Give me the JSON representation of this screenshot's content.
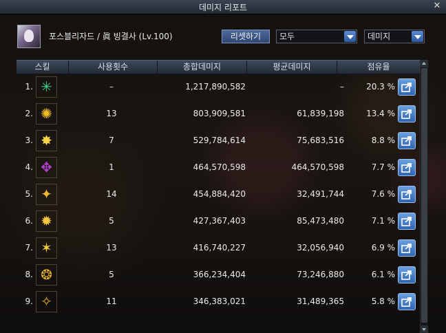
{
  "window": {
    "title": "데미지 리포트",
    "close_glyph": "✕"
  },
  "character": {
    "name": "포스블리자드 / 眞 빙결사 (Lv.100)"
  },
  "controls": {
    "reset_label": "리셋하기",
    "filter_value": "모두",
    "sort_value": "데미지"
  },
  "columns": {
    "skill": "스킬",
    "uses": "사용횟수",
    "total": "총합데미지",
    "avg": "평균데미지",
    "share": "점유율"
  },
  "rows": [
    {
      "rank": "1.",
      "icon": "green-frost-skill-icon",
      "icon_color": "#3fd08a",
      "icon_glyph": "✳",
      "uses": "–",
      "total": "1,217,890,582",
      "avg": "–",
      "pct": "20.3 %"
    },
    {
      "rank": "2.",
      "icon": "golden-flame-skill-icon",
      "icon_color": "#f4c02a",
      "icon_glyph": "✺",
      "uses": "13",
      "total": "803,909,581",
      "avg": "61,839,198",
      "pct": "13.4 %"
    },
    {
      "rank": "3.",
      "icon": "golden-burst-skill-icon",
      "icon_color": "#f7d34a",
      "icon_glyph": "✸",
      "uses": "7",
      "total": "529,784,614",
      "avg": "75,683,516",
      "pct": "8.8 %"
    },
    {
      "rank": "4.",
      "icon": "purple-rune-skill-icon",
      "icon_color": "#b040d0",
      "icon_glyph": "✥",
      "uses": "1",
      "total": "464,570,598",
      "avg": "464,570,598",
      "pct": "7.7 %"
    },
    {
      "rank": "5.",
      "icon": "golden-shards-skill-icon",
      "icon_color": "#f0b830",
      "icon_glyph": "✦",
      "uses": "14",
      "total": "454,884,420",
      "avg": "32,491,744",
      "pct": "7.6 %"
    },
    {
      "rank": "6.",
      "icon": "golden-explosion-skill-icon",
      "icon_color": "#f6c640",
      "icon_glyph": "✹",
      "uses": "5",
      "total": "427,367,403",
      "avg": "85,473,480",
      "pct": "7.1 %"
    },
    {
      "rank": "7.",
      "icon": "golden-star-skill-icon",
      "icon_color": "#f3cd3c",
      "icon_glyph": "✶",
      "uses": "13",
      "total": "416,740,227",
      "avg": "32,056,940",
      "pct": "6.9 %"
    },
    {
      "rank": "8.",
      "icon": "golden-eye-skill-icon",
      "icon_color": "#e9b22a",
      "icon_glyph": "❂",
      "uses": "5",
      "total": "366,234,404",
      "avg": "73,246,880",
      "pct": "6.1 %"
    },
    {
      "rank": "9.",
      "icon": "golden-bow-skill-icon",
      "icon_color": "#eab02c",
      "icon_glyph": "✧",
      "uses": "11",
      "total": "346,383,021",
      "avg": "31,489,365",
      "pct": "5.8 %"
    }
  ]
}
